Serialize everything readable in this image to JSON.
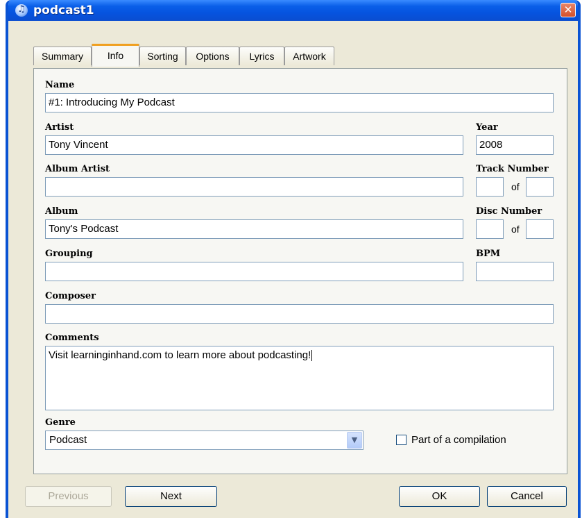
{
  "window": {
    "title": "podcast1",
    "close_glyph": "✕"
  },
  "tabs": [
    "Summary",
    "Info",
    "Sorting",
    "Options",
    "Lyrics",
    "Artwork"
  ],
  "active_tab": "Info",
  "form": {
    "name": {
      "label": "Name",
      "value": "#1: Introducing My Podcast"
    },
    "artist": {
      "label": "Artist",
      "value": "Tony Vincent"
    },
    "year": {
      "label": "Year",
      "value": "2008"
    },
    "album_artist": {
      "label": "Album Artist",
      "value": ""
    },
    "track_number": {
      "label": "Track Number",
      "of": "of",
      "value": "",
      "total": ""
    },
    "album": {
      "label": "Album",
      "value": "Tony's Podcast"
    },
    "disc_number": {
      "label": "Disc Number",
      "of": "of",
      "value": "",
      "total": ""
    },
    "grouping": {
      "label": "Grouping",
      "value": ""
    },
    "bpm": {
      "label": "BPM",
      "value": ""
    },
    "composer": {
      "label": "Composer",
      "value": ""
    },
    "comments": {
      "label": "Comments",
      "value": "Visit learninginhand.com to learn more about podcasting!"
    },
    "genre": {
      "label": "Genre",
      "value": "Podcast"
    },
    "compilation": {
      "label": "Part of a compilation",
      "checked": false
    }
  },
  "buttons": {
    "previous": "Previous",
    "next": "Next",
    "ok": "OK",
    "cancel": "Cancel"
  },
  "icons": {
    "app": "itunes-icon",
    "close": "close-icon",
    "dropdown": "chevron-down-icon"
  },
  "colors": {
    "titlebar": "#0A5FE8",
    "close": "#D4502A",
    "tab_highlight": "#F0A020",
    "window_bg": "#ECE9D8"
  }
}
